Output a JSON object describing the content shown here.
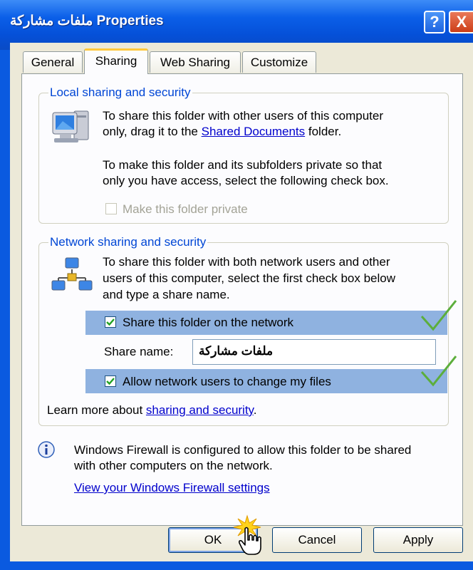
{
  "window": {
    "title": "ملفات مشاركة Properties",
    "help_label": "?",
    "close_label": "X"
  },
  "tabs": [
    {
      "label": "General",
      "active": false
    },
    {
      "label": "Sharing",
      "active": true
    },
    {
      "label": "Web Sharing",
      "active": false
    },
    {
      "label": "Customize",
      "active": false
    }
  ],
  "local_group": {
    "legend": "Local sharing and security",
    "text1_line1": "To share this folder with other users of this computer",
    "text1_line2_before": "only, drag it to the ",
    "text1_link": "Shared Documents",
    "text1_line2_after": " folder.",
    "text2_line1": "To make this folder and its subfolders private so that",
    "text2_line2": "only you have access, select the following check box.",
    "private_checkbox_label": "Make this folder private",
    "private_checked": false,
    "private_enabled": false
  },
  "network_group": {
    "legend": "Network sharing and security",
    "text_line1": "To share this folder with both network users and other",
    "text_line2": "users of this computer, select the first check box below",
    "text_line3": "and type a share name.",
    "share_checkbox_label": "Share this folder on the network",
    "share_checked": true,
    "share_name_label": "Share name:",
    "share_name_value": "ملفات مشاركة",
    "allow_checkbox_label": "Allow network users to change my files",
    "allow_checked": true,
    "learn_before": "Learn more about ",
    "learn_link": "sharing and security",
    "learn_after": "."
  },
  "firewall": {
    "line1": "Windows Firewall is configured to allow this folder to be shared",
    "line2": "with other computers on the network.",
    "link": "View your Windows Firewall settings"
  },
  "buttons": {
    "ok": "OK",
    "cancel": "Cancel",
    "apply": "Apply"
  },
  "colors": {
    "titlebar": "#0550d8",
    "dialog_bg": "#ece9d8",
    "legend_text": "#0046d5",
    "highlight": "#8fb2e0",
    "checkmark": "#4aa02c"
  }
}
